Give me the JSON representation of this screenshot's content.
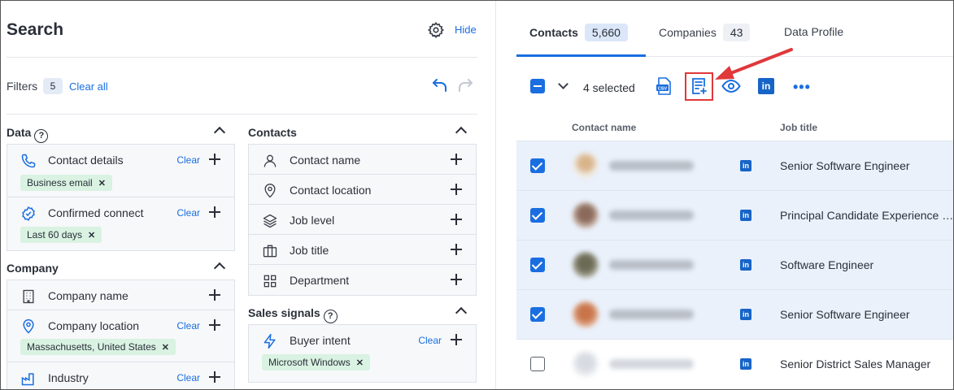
{
  "search": {
    "title": "Search",
    "hide_label": "Hide",
    "filters_label": "Filters",
    "filters_count": "5",
    "clear_all_label": "Clear all"
  },
  "data_section": {
    "title": "Data",
    "items": [
      {
        "label": "Contact details",
        "clear": "Clear",
        "chip": "Business email",
        "icon": "phone-icon"
      },
      {
        "label": "Confirmed connect",
        "clear": "Clear",
        "chip": "Last 60 days",
        "icon": "check-circle-icon"
      }
    ]
  },
  "company_section": {
    "title": "Company",
    "items": [
      {
        "label": "Company name",
        "icon": "building-icon"
      },
      {
        "label": "Company location",
        "clear": "Clear",
        "chip": "Massachusetts, United States",
        "icon": "location-pin-icon"
      },
      {
        "label": "Industry",
        "clear": "Clear",
        "icon": "industry-icon"
      }
    ]
  },
  "contacts_section": {
    "title": "Contacts",
    "items": [
      {
        "label": "Contact name",
        "icon": "person-icon"
      },
      {
        "label": "Contact location",
        "icon": "location-pin-icon"
      },
      {
        "label": "Job level",
        "icon": "layers-icon"
      },
      {
        "label": "Job title",
        "icon": "briefcase-icon"
      },
      {
        "label": "Department",
        "icon": "grid-icon"
      }
    ]
  },
  "sales_section": {
    "title": "Sales signals",
    "items": [
      {
        "label": "Buyer intent",
        "clear": "Clear",
        "chip": "Microsoft Windows",
        "icon": "lightning-icon"
      }
    ]
  },
  "tabs": [
    {
      "label": "Contacts",
      "count": "5,660"
    },
    {
      "label": "Companies",
      "count": "43"
    },
    {
      "label": "Data Profile"
    }
  ],
  "toolbar": {
    "selected_text": "4 selected",
    "csv_label": "CSV"
  },
  "table": {
    "headers": [
      "Contact name",
      "Job title"
    ],
    "rows": [
      {
        "selected": true,
        "job_title": "Senior Software Engineer",
        "li": "in"
      },
      {
        "selected": true,
        "job_title": "Principal Candidate Experience Manager",
        "li": "in"
      },
      {
        "selected": true,
        "job_title": "Software Engineer",
        "li": "in"
      },
      {
        "selected": true,
        "job_title": "Senior Software Engineer",
        "li": "in"
      },
      {
        "selected": false,
        "job_title": "Senior District Sales Manager",
        "li": "in"
      }
    ]
  },
  "colors": {
    "accent": "#1a6ee0",
    "chip_bg": "#d9f2e2",
    "highlight_red": "#e0383b",
    "selected_row": "#eaf1fb"
  }
}
